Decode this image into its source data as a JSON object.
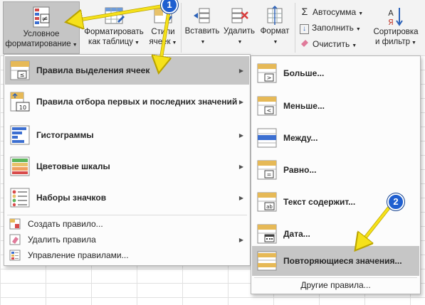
{
  "ribbon": {
    "conditional_formatting": {
      "line1": "Условное",
      "line2": "форматирование"
    },
    "format_as_table": {
      "line1": "Форматировать",
      "line2": "как таблицу"
    },
    "cell_styles": {
      "line1": "Стили",
      "line2": "ячеек"
    },
    "insert": "Вставить",
    "delete": "Удалить",
    "format": "Формат",
    "autosum": "Автосумма",
    "fill": "Заполнить",
    "clear": "Очистить",
    "sort_filter": {
      "line1": "Сортировка",
      "line2": "и фильтр"
    }
  },
  "main_menu": {
    "items": [
      {
        "label": "Правила выделения ячеек",
        "icon": "highlight-cells-rules-icon",
        "has_submenu": true
      },
      {
        "label": "Правила отбора первых и последних значений",
        "icon": "top-bottom-rules-icon",
        "has_submenu": true
      },
      {
        "label": "Гистограммы",
        "icon": "data-bars-icon",
        "has_submenu": true
      },
      {
        "label": "Цветовые шкалы",
        "icon": "color-scales-icon",
        "has_submenu": true
      },
      {
        "label": "Наборы значков",
        "icon": "icon-sets-icon",
        "has_submenu": true
      }
    ],
    "actions": [
      {
        "label": "Создать правило...",
        "icon": "new-rule-icon"
      },
      {
        "label": "Удалить правила",
        "icon": "clear-rules-icon",
        "has_submenu": true
      },
      {
        "label": "Управление правилами...",
        "icon": "manage-rules-icon"
      }
    ]
  },
  "submenu": {
    "items": [
      {
        "label": "Больше...",
        "symbol": ">"
      },
      {
        "label": "Меньше...",
        "symbol": "<"
      },
      {
        "label": "Между...",
        "symbol": ""
      },
      {
        "label": "Равно...",
        "symbol": "="
      },
      {
        "label": "Текст содержит...",
        "symbol": "ab"
      },
      {
        "label": "Дата...",
        "symbol": "cal"
      },
      {
        "label": "Повторяющиеся значения...",
        "symbol": "dup"
      }
    ],
    "footer": "Другие правила..."
  },
  "annotations": {
    "badge1": "1",
    "badge2": "2",
    "arrow_color": "#f5e11a"
  },
  "colors": {
    "highlight": "#c6c6c6",
    "ribbon_bg": "#f3f3f3",
    "badge": "#1f5fd0"
  }
}
